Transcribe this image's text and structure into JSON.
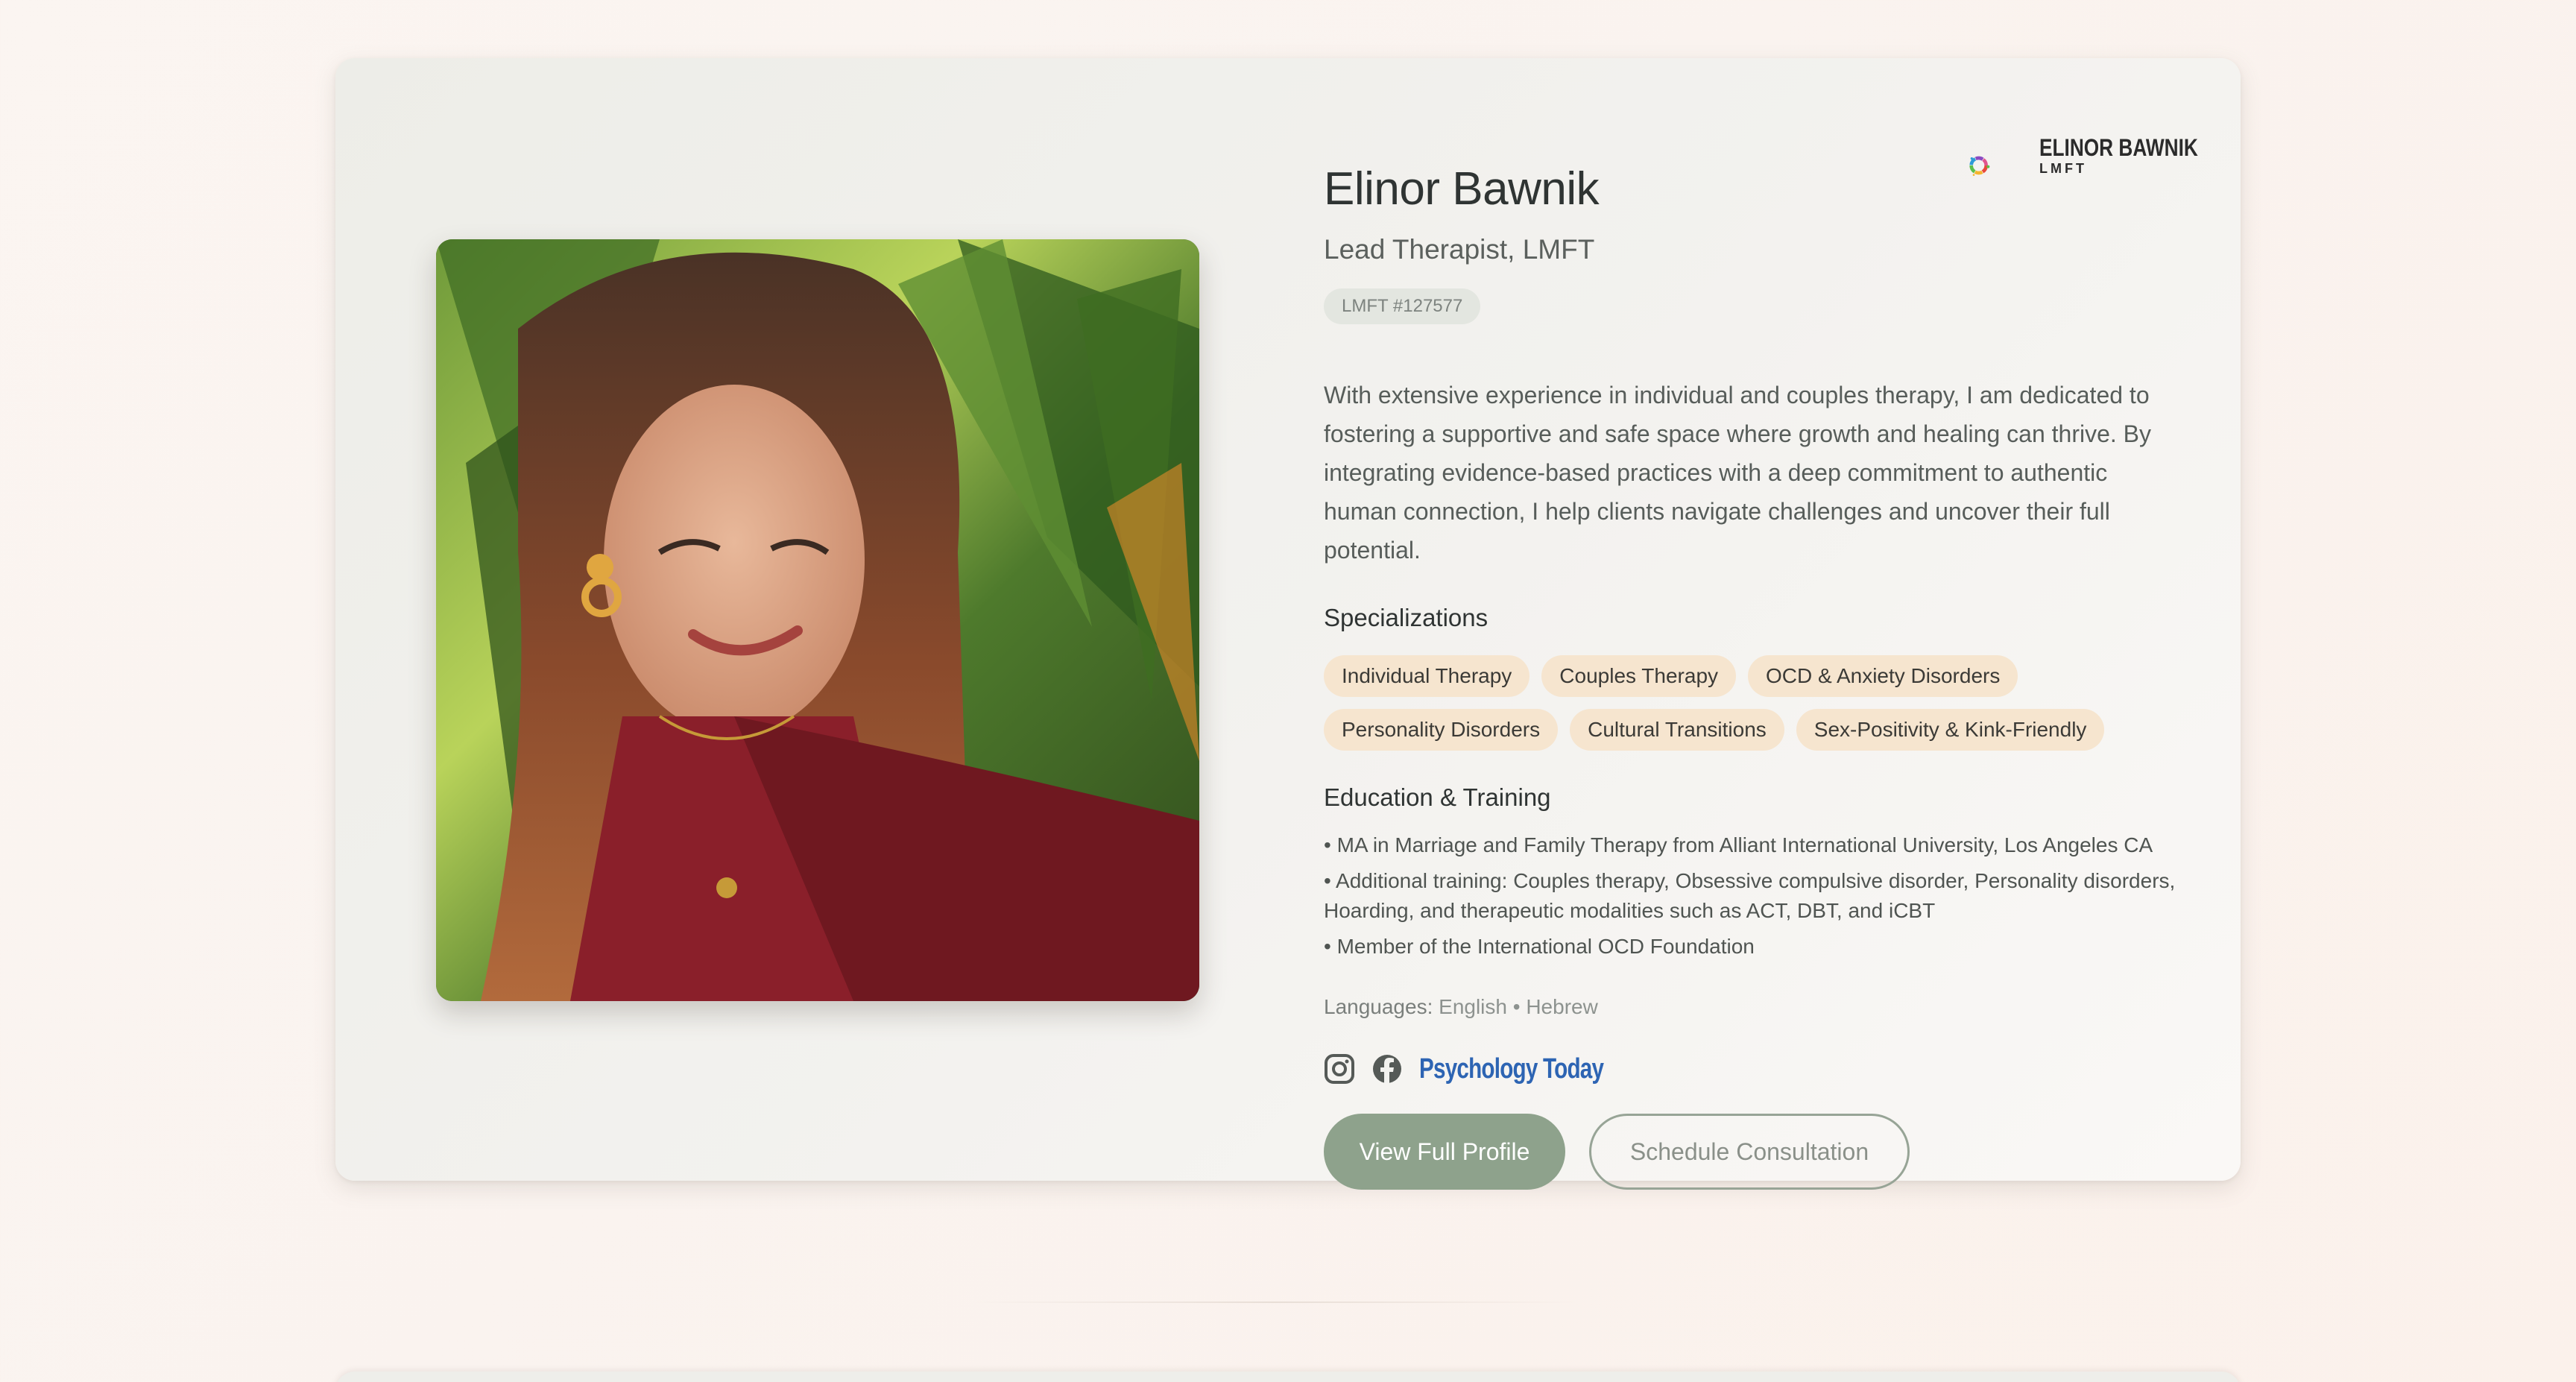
{
  "therapist": {
    "name": "Elinor Bawnik",
    "role": "Lead Therapist, LMFT",
    "license": "LMFT #127577",
    "photo_alt": "Elinor Bawnik portrait",
    "bio": "With extensive experience in individual and couples therapy, I am dedicated to fostering a supportive and safe space where growth and healing can thrive. By integrating evidence-based practices with a deep commitment to authentic human connection, I help clients navigate challenges and uncover their full potential."
  },
  "logo": {
    "line1": "ELINOR BAWNIK",
    "line2": "LMFT",
    "icon": "colorful-ring-logo-icon"
  },
  "specializations": {
    "title": "Specializations",
    "row1": [
      "Individual Therapy",
      "Couples Therapy",
      "OCD & Anxiety Disorders"
    ],
    "row2": [
      "Personality Disorders",
      "Cultural Transitions",
      "Sex-Positivity & Kink-Friendly"
    ]
  },
  "education": {
    "title": "Education & Training",
    "items": [
      "• MA in Marriage and Family Therapy from Alliant International University, Los Angeles CA",
      "• Additional training: Couples therapy, Obsessive compulsive disorder, Personality disorders, Hoarding, and therapeutic modalities such as ACT, DBT, and iCBT",
      "• Member of the International OCD Foundation"
    ]
  },
  "languages": {
    "label": "Languages:",
    "value": "English • Hebrew"
  },
  "social": {
    "instagram_icon": "instagram-icon",
    "facebook_icon": "facebook-icon",
    "psychology_today": "Psychology Today"
  },
  "actions": {
    "primary": "View Full Profile",
    "secondary": "Schedule Consultation"
  },
  "colors": {
    "accent": "#8ea28c",
    "chip_bg": "#f6e5cf",
    "link_blue": "#2d64b3"
  }
}
